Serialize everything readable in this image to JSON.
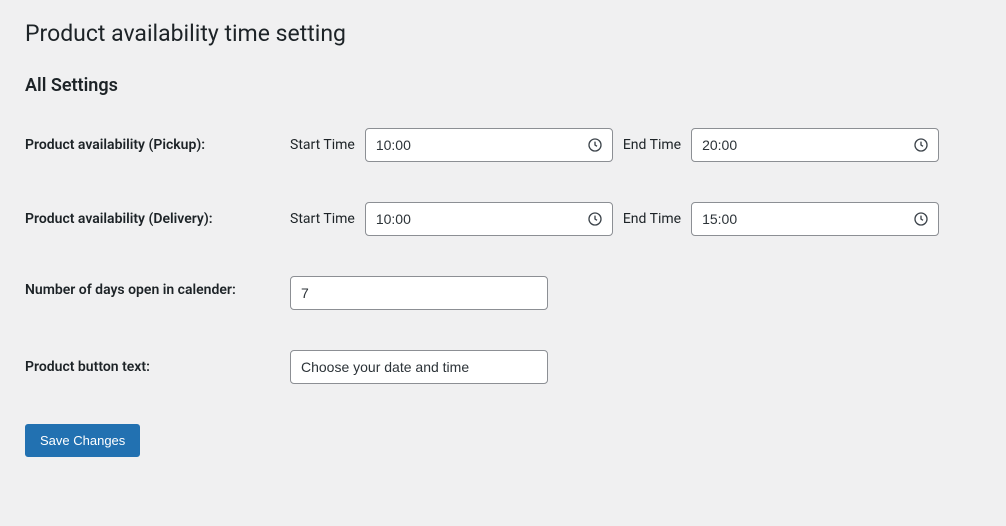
{
  "page": {
    "title": "Product availability time setting",
    "subtitle": "All Settings"
  },
  "rows": {
    "pickup": {
      "label": "Product availability (Pickup):",
      "start_label": "Start Time",
      "start_value": "10:00",
      "end_label": "End Time",
      "end_value": "20:00"
    },
    "delivery": {
      "label": "Product availability (Delivery):",
      "start_label": "Start Time",
      "start_value": "10:00",
      "end_label": "End Time",
      "end_value": "15:00"
    },
    "days": {
      "label": "Number of days open in calender:",
      "value": "7"
    },
    "button_text": {
      "label": "Product button text:",
      "value": "Choose your date and time"
    }
  },
  "actions": {
    "save_label": "Save Changes"
  }
}
